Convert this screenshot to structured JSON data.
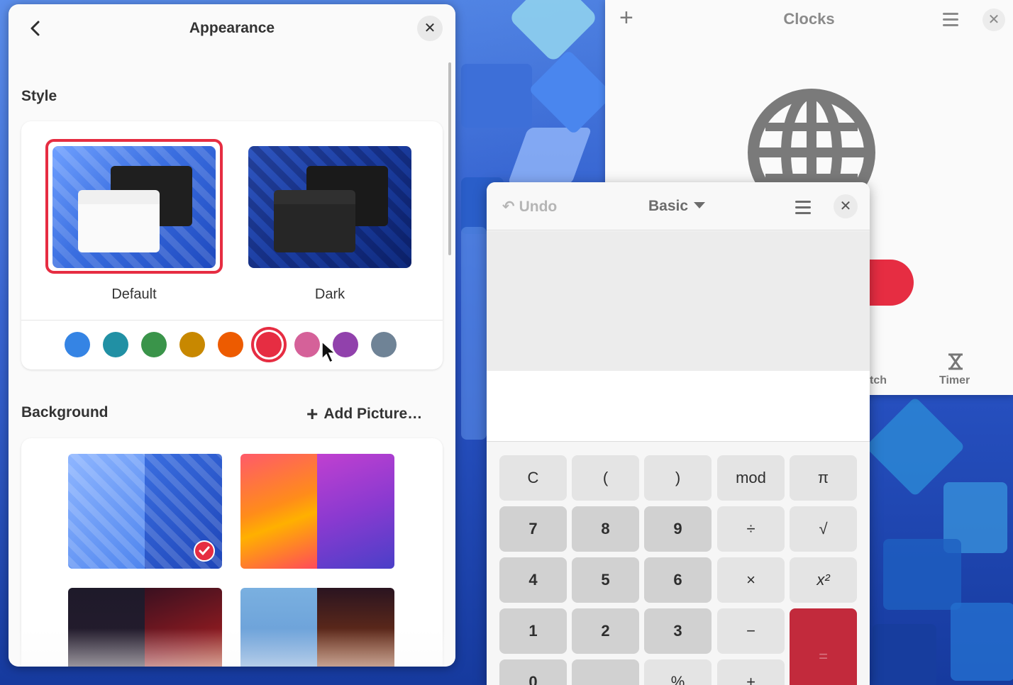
{
  "settings": {
    "title": "Appearance",
    "style_section": "Style",
    "styles": [
      {
        "label": "Default",
        "selected": true
      },
      {
        "label": "Dark",
        "selected": false
      }
    ],
    "accent_colors": [
      {
        "name": "blue",
        "hex": "#3584e4"
      },
      {
        "name": "teal",
        "hex": "#2190a4"
      },
      {
        "name": "green",
        "hex": "#3a944a"
      },
      {
        "name": "yellow",
        "hex": "#c88800"
      },
      {
        "name": "orange",
        "hex": "#ed5b00"
      },
      {
        "name": "red",
        "hex": "#e62d42",
        "selected": true
      },
      {
        "name": "pink",
        "hex": "#d56199"
      },
      {
        "name": "purple",
        "hex": "#9141ac"
      },
      {
        "name": "slate",
        "hex": "#6f8396"
      }
    ],
    "background_section": "Background",
    "add_picture": "Add Picture…"
  },
  "clocks": {
    "title": "Clocks",
    "pill_text": "…",
    "stopwatch_partial": "tch",
    "timer": "Timer"
  },
  "calculator": {
    "undo": "Undo",
    "mode": "Basic",
    "keys": [
      [
        "C",
        "(",
        ")",
        "mod",
        "π"
      ],
      [
        "7",
        "8",
        "9",
        "÷",
        "√"
      ],
      [
        "4",
        "5",
        "6",
        "×",
        "x²"
      ],
      [
        "1",
        "2",
        "3",
        "−",
        "="
      ],
      [
        "0",
        "",
        "%",
        "+",
        ""
      ]
    ]
  },
  "colors": {
    "accent": "#e62d42",
    "window_bg": "#fafafa"
  }
}
